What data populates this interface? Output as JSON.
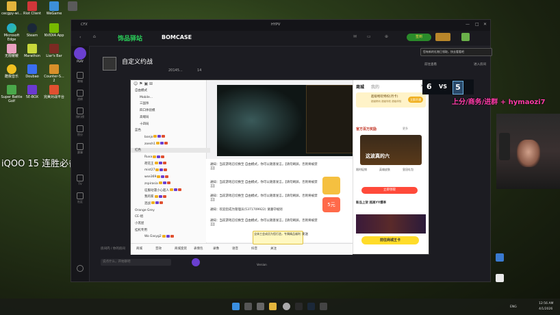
{
  "desktop": {
    "icons_col1": [
      {
        "label": "cecgpy-wi..."
      },
      {
        "label": "Microsoft Edge"
      },
      {
        "label": "无限暖暖"
      },
      {
        "label": "酷我音乐"
      },
      {
        "label": "Super Battle Golf"
      }
    ],
    "icons_col2": [
      {
        "label": "Riot Client"
      },
      {
        "label": "Steam"
      },
      {
        "label": "Marathon"
      },
      {
        "label": "Doubao"
      },
      {
        "label": "5E-BOX"
      }
    ],
    "icons_col3": [
      {
        "label": "WeGame"
      },
      {
        "label": "NVIDIA App"
      },
      {
        "label": "Liar's Bar"
      },
      {
        "label": "Counter-S... 2"
      },
      {
        "label": "完美对战平台"
      }
    ],
    "overlay_text": "iQOO 15 连胜必备",
    "streamer_overlay": "上分/商务/进群 + hymaozi7"
  },
  "app": {
    "logo": "CFX",
    "window_title": "HYPV",
    "brand1": "饰品驿站",
    "brand2": "BOMCASE",
    "vip_label": "签到",
    "room_title": "自定义约战",
    "room_meta_id": "20145...",
    "room_meta_count": "14",
    "notice_text": "您有新的礼物已领取，快去看看吧",
    "enter_room": "进入房间",
    "notice_link": "前往查看",
    "sidebar": [
      {
        "label": "PLAY"
      },
      {
        "label": "商城"
      },
      {
        "label": "战绩"
      },
      {
        "label": "排行榜"
      },
      {
        "label": "积分"
      },
      {
        "label": "赛事"
      },
      {
        "label": "TV"
      },
      {
        "label": "社区"
      },
      {
        "label": "设置"
      }
    ],
    "bottom_input_placeholder": "说点什么，开始聊吧",
    "room_label": "房间内 / 你的房间",
    "voice_btn": "语音",
    "version": "Version"
  },
  "score": {
    "left": "6",
    "vs": "VS",
    "right": "5"
  },
  "inner": {
    "tabs": [
      "商城",
      "我的"
    ],
    "tree": [
      {
        "label": "自由模式",
        "indent": 0
      },
      {
        "label": "Mobile...",
        "indent": 1
      },
      {
        "label": "三国杀",
        "indent": 1
      },
      {
        "label": "四口体验模",
        "indent": 1
      },
      {
        "label": "高端局",
        "indent": 1
      },
      {
        "label": "十四局",
        "indent": 1
      },
      {
        "label": "蓝色",
        "indent": 0
      },
      {
        "label": "banjo",
        "indent": 2
      },
      {
        "label": "zoesh1",
        "indent": 2
      },
      {
        "label": "红色",
        "indent": 0
      },
      {
        "label": "Ruxa",
        "indent": 2
      },
      {
        "label": "荷花王",
        "indent": 2
      },
      {
        "label": "mist27",
        "indent": 2
      },
      {
        "label": "wse369",
        "indent": 2
      },
      {
        "label": "zspirasia",
        "indent": 2
      },
      {
        "label": "征服动漫小心超人",
        "indent": 2
      },
      {
        "label": "我的家",
        "indent": 2
      },
      {
        "label": "混战",
        "indent": 2
      },
      {
        "label": "Orange Grey",
        "indent": 0
      },
      {
        "label": "CE-组",
        "indent": 0
      },
      {
        "label": "小黑屋",
        "indent": 0
      },
      {
        "label": "挂机专用",
        "indent": 0
      },
      {
        "label": "Wo Easyg2",
        "indent": 2
      }
    ],
    "messages": [
      "通知：当前游戏已切换至 自由模式，你可以随意发言。【请勿刷屏，否则将被禁言】",
      "通知：当前游戏已切换至 自由模式，你可以随意发言。【请勿刷屏，否则将被禁言】",
      "通知：当前游戏已切换至 自由模式，你可以随意发言。【请勿刷屏，否则将被禁言】",
      "通知：欢迎您成为管理员(5371709922) 请遵守规则",
      "通知：当前游戏已切换至 自由模式，你可以随意发言。【请勿刷屏，否则将被禁言】"
    ],
    "shop": {
      "vip_title": "超级畅玩特权(月卡)",
      "vip_sub": "超级畅玩 超级特权 超级体验",
      "vip_btn": "立即开通",
      "section": "官方百万奖励",
      "more": "更多",
      "promo": "这波真的六",
      "tags": [
        "限时促销",
        "英雄皮肤",
        "皇冠礼包"
      ],
      "claim_btn": "立即领取",
      "title2": "新品上架 超高YY爆率",
      "buy_btn": "前往商城王卡",
      "promo_badge": "5元"
    },
    "bottombar": {
      "items": [
        "商城",
        "音效",
        "商城变装",
        "表情包",
        "录像",
        "语音",
        "抖音",
        "关注"
      ],
      "notice": "全体工会成员为您打造，专属精品福利",
      "send": "发送"
    }
  },
  "taskbar": {
    "time": "12:56 AM",
    "date": "4/1/2026",
    "lang": "ENG"
  }
}
